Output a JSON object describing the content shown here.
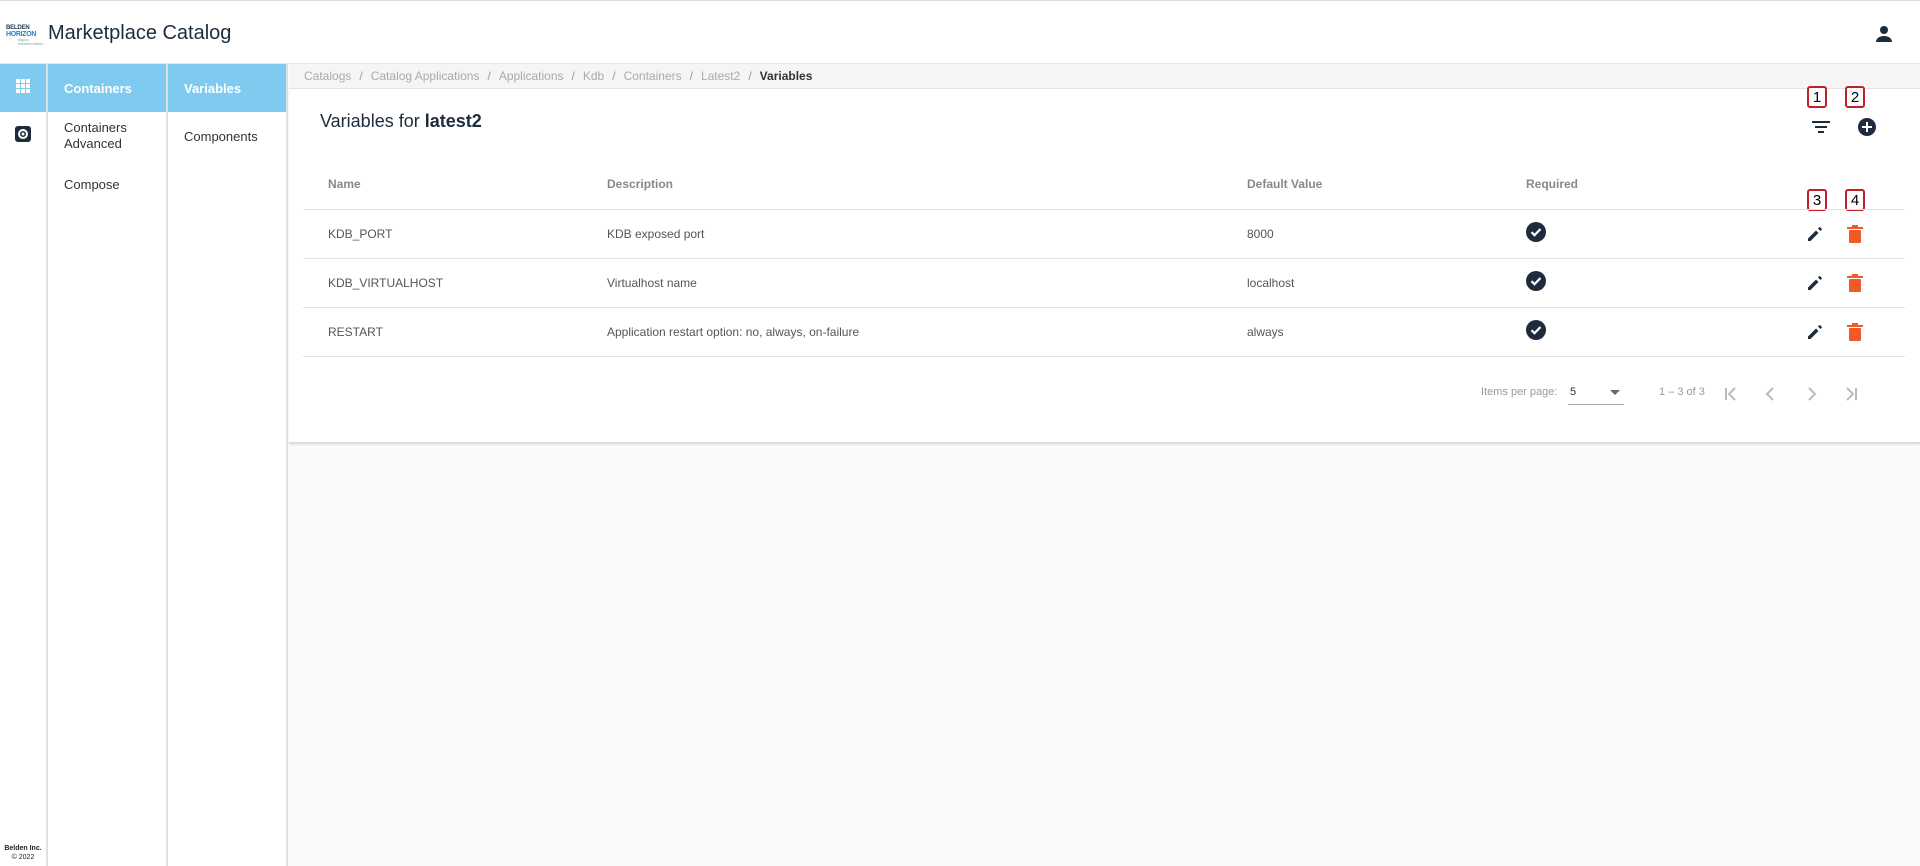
{
  "header": {
    "logo": {
      "line1": "BELDEN",
      "line2": "HORIZON",
      "line3": "digital transformation"
    },
    "title": "Marketplace Catalog"
  },
  "rail": {
    "footer_company": "Belden Inc.",
    "footer_copyright": "© 2022"
  },
  "subnav1": {
    "items": [
      {
        "label": "Containers",
        "active": true
      },
      {
        "label": "Containers Advanced",
        "active": false
      },
      {
        "label": "Compose",
        "active": false
      }
    ]
  },
  "subnav2": {
    "items": [
      {
        "label": "Variables",
        "active": true
      },
      {
        "label": "Components",
        "active": false
      }
    ]
  },
  "breadcrumb": {
    "items": [
      "Catalogs",
      "Catalog Applications",
      "Applications",
      "Kdb",
      "Containers",
      "Latest2"
    ],
    "current": "Variables"
  },
  "card": {
    "title_prefix": "Variables for",
    "title_name": "latest2"
  },
  "annotations": [
    "1",
    "2",
    "3",
    "4"
  ],
  "table": {
    "headers": {
      "name": "Name",
      "description": "Description",
      "default_value": "Default Value",
      "required": "Required"
    },
    "rows": [
      {
        "name": "KDB_PORT",
        "description": "KDB exposed port",
        "default_value": "8000",
        "required": true
      },
      {
        "name": "KDB_VIRTUALHOST",
        "description": "Virtualhost name",
        "default_value": "localhost",
        "required": true
      },
      {
        "name": "RESTART",
        "description": "Application restart option: no, always, on-failure",
        "default_value": "always",
        "required": true
      }
    ]
  },
  "paginator": {
    "items_per_page_label": "Items per page:",
    "items_per_page_value": "5",
    "range": "1 – 3 of 3"
  },
  "colors": {
    "accent": "#7ecbef",
    "icon_dark": "#1c2c3c",
    "delete": "#f05a28",
    "annotation_border": "#c0202a"
  }
}
